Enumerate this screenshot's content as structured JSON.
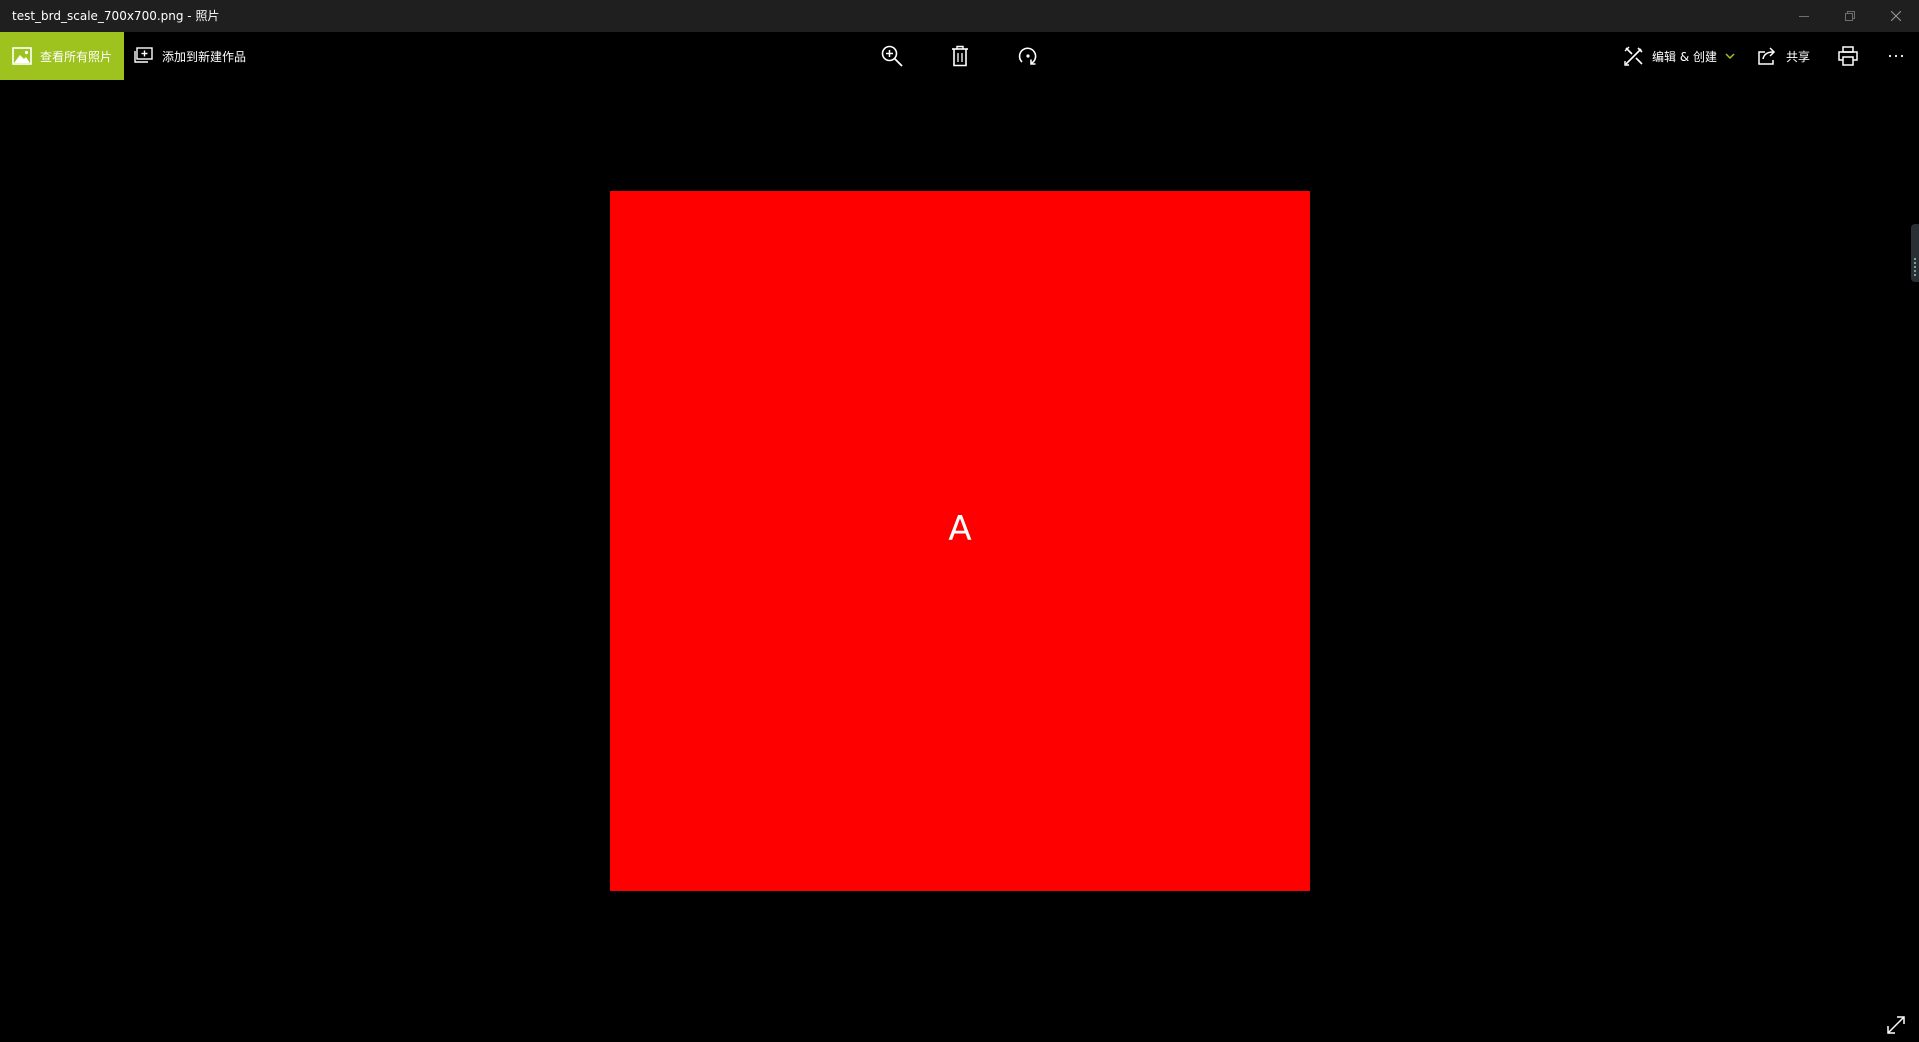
{
  "window": {
    "title": "test_brd_scale_700x700.png - 照片"
  },
  "toolbar": {
    "view_all_label": "查看所有照片",
    "add_to_creation_label": "添加到新建作品",
    "edit_create_label": "编辑 & 创建",
    "share_label": "共享"
  },
  "photo": {
    "letter": "A",
    "fill_color": "#ff0000",
    "native_size_text": "700x700"
  },
  "colors": {
    "accent": "#9ec31f",
    "titlebar_bg": "#1f1f1f",
    "canvas_bg": "#000000"
  },
  "icons": {
    "view_all": "photos-gallery-icon",
    "add_creation": "add-to-creation-icon",
    "zoom": "zoom-in-icon",
    "delete": "delete-icon",
    "rotate": "rotate-icon",
    "edit_create": "edit-create-icon",
    "dropdown": "chevron-down-icon",
    "share": "share-icon",
    "print": "print-icon",
    "more": "more-icon",
    "fullscreen": "fullscreen-icon"
  }
}
